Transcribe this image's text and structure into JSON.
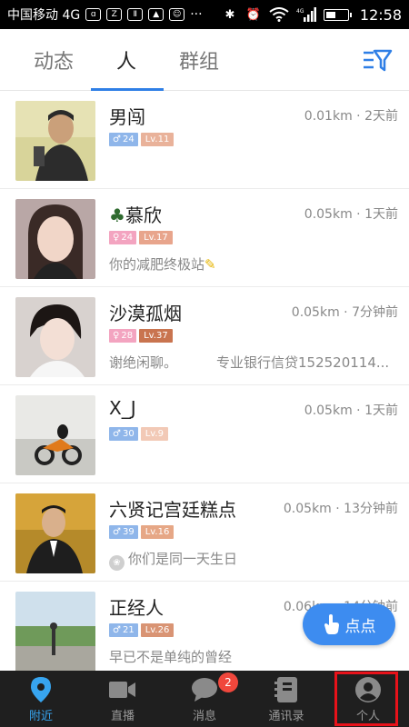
{
  "status_bar": {
    "carrier": "中国移动 4G",
    "time": "12:58",
    "network": "4G"
  },
  "tabs": [
    {
      "label": "动态",
      "active": false
    },
    {
      "label": "人",
      "active": true
    },
    {
      "label": "群组",
      "active": false
    }
  ],
  "users": [
    {
      "name": "男闯",
      "distance": "0.01km",
      "time": "2天前",
      "gender": "male",
      "age": "24",
      "level": "Lv.11",
      "signature": "",
      "signature_extra": ""
    },
    {
      "name": "慕欣",
      "distance": "0.05km",
      "time": "1天前",
      "gender": "female",
      "age": "24",
      "level": "Lv.17",
      "signature": "你的减肥终极站",
      "signature_extra": ""
    },
    {
      "name": "沙漠孤烟",
      "distance": "0.05km",
      "time": "7分钟前",
      "gender": "female",
      "age": "28",
      "level": "Lv.37",
      "signature": "谢绝闲聊。",
      "signature_extra": "专业银行信贷152520114..."
    },
    {
      "name": "X_J",
      "distance": "0.05km",
      "time": "1天前",
      "gender": "male",
      "age": "30",
      "level": "Lv.9",
      "signature": "",
      "signature_extra": ""
    },
    {
      "name": "六贤记宫廷糕点",
      "distance": "0.05km",
      "time": "13分钟前",
      "gender": "male",
      "age": "39",
      "level": "Lv.16",
      "signature": "你们是同一天生日",
      "signature_extra": ""
    },
    {
      "name": "正经人",
      "distance": "0.06km",
      "time": "14分钟前",
      "gender": "male",
      "age": "21",
      "level": "Lv.26",
      "signature": "早已不是单纯的曾经",
      "signature_extra": ""
    }
  ],
  "float_button": {
    "label": "点点"
  },
  "bottom_nav": [
    {
      "label": "附近",
      "icon": "location-pin-icon",
      "active": true
    },
    {
      "label": "直播",
      "icon": "video-camera-icon",
      "active": false
    },
    {
      "label": "消息",
      "icon": "chat-bubble-icon",
      "active": false,
      "badge": "2"
    },
    {
      "label": "通讯录",
      "icon": "contacts-book-icon",
      "active": false
    },
    {
      "label": "个人",
      "icon": "user-profile-icon",
      "active": false
    }
  ],
  "colors": {
    "accent": "#2f7fe6",
    "nav_active": "#37a5f0",
    "badge_red": "#f0473c",
    "highlight": "#e8121a"
  }
}
